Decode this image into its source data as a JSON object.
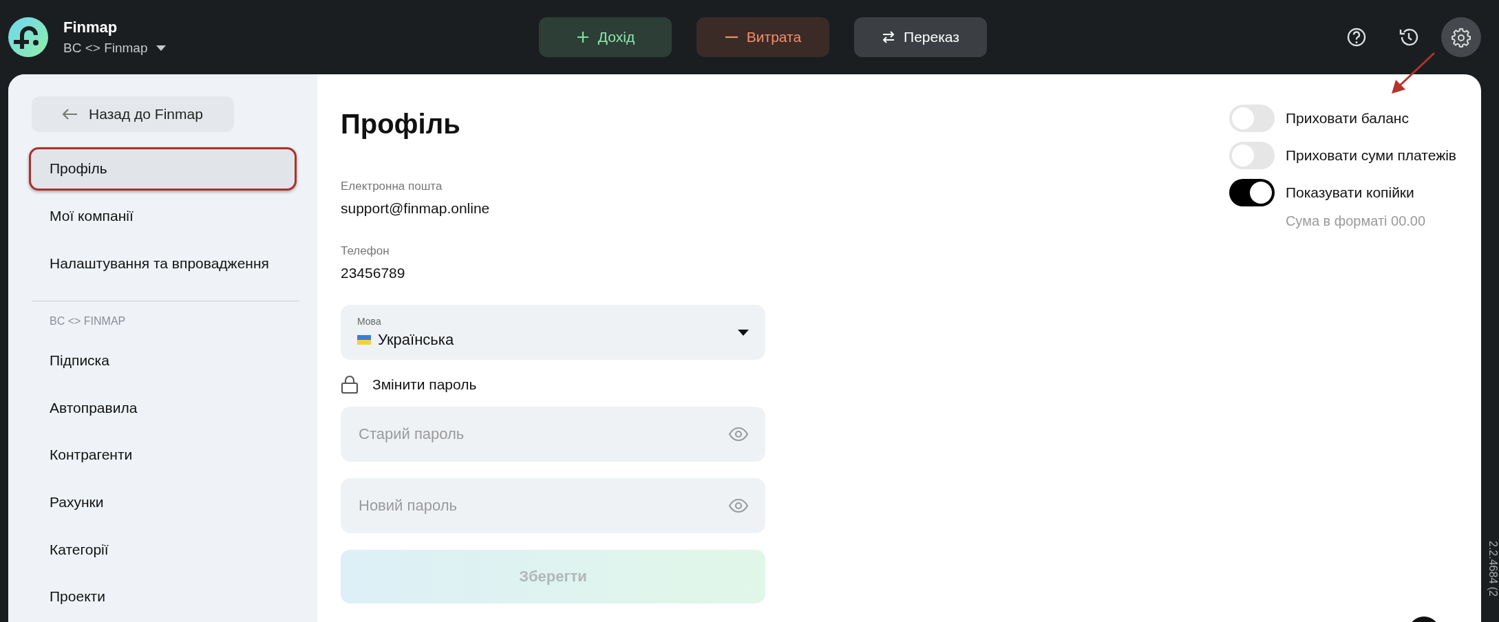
{
  "header": {
    "app_name": "Finmap",
    "workspace": "BC <> Finmap",
    "actions": [
      {
        "kind": "income",
        "label": "Дохід"
      },
      {
        "kind": "expense",
        "label": "Витрата"
      },
      {
        "kind": "transfer",
        "label": "Переказ"
      }
    ],
    "tools": [
      {
        "kind": "help",
        "active": false
      },
      {
        "kind": "history",
        "active": false
      },
      {
        "kind": "settings",
        "active": true
      }
    ]
  },
  "sidebar": {
    "back_button": "Назад до Finmap",
    "items": [
      {
        "label": "Профіль",
        "selected": true,
        "annotated": true
      },
      {
        "label": "Мої компанії",
        "selected": false,
        "annotated": false
      },
      {
        "label": "Налаштування та впровадження",
        "selected": false,
        "annotated": false
      }
    ],
    "section_label": "BC <> FINMAP",
    "section_items": [
      {
        "label": "Підписка",
        "selected": false
      },
      {
        "label": "Автоправила",
        "selected": false
      },
      {
        "label": "Контрагенти",
        "selected": false
      },
      {
        "label": "Рахунки",
        "selected": false
      },
      {
        "label": "Категорії",
        "selected": false
      },
      {
        "label": "Проекти",
        "selected": false
      }
    ]
  },
  "profile": {
    "title": "Профіль",
    "info": [
      {
        "label": "Електронна пошта",
        "value": "support@finmap.online"
      },
      {
        "label": "Телефон",
        "value": "23456789"
      }
    ],
    "language": {
      "label": "Мова",
      "value": "Українська"
    },
    "change_password": "Змінити пароль",
    "password_fields": [
      {
        "placeholder": "Старий пароль"
      },
      {
        "placeholder": "Новий пароль"
      }
    ],
    "save_button": {
      "label": "Зберегти",
      "disabled": true
    }
  },
  "toggles": [
    {
      "label": "Приховати баланс",
      "on": false
    },
    {
      "label": "Приховати суми платежів",
      "on": false
    },
    {
      "label": "Показувати копійки",
      "on": true,
      "hint": "Сума в форматі 00.00"
    }
  ],
  "annotation_arrow": true,
  "version": "2.2.4684 (2"
}
